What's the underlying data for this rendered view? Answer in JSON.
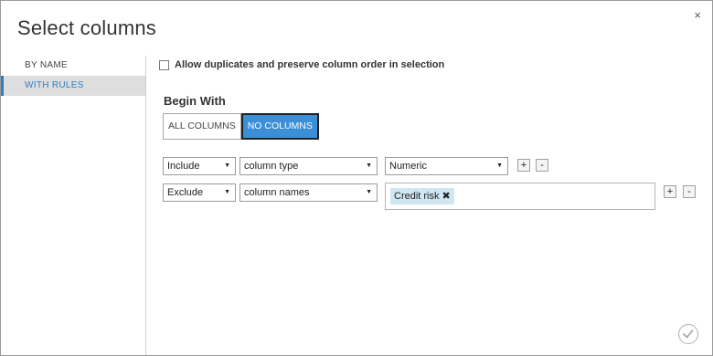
{
  "dialog": {
    "title": "Select columns",
    "close_glyph": "×"
  },
  "sidebar": {
    "items": [
      {
        "label": "BY NAME",
        "active": false
      },
      {
        "label": "WITH RULES",
        "active": true
      }
    ]
  },
  "allow": {
    "label": "Allow duplicates and preserve column order in selection",
    "checked": false
  },
  "begin_with": {
    "label": "Begin With",
    "options": [
      "ALL COLUMNS",
      "NO COLUMNS"
    ],
    "selected": "NO COLUMNS"
  },
  "rules": [
    {
      "action": "Include",
      "criterion": "column type",
      "value": "Numeric",
      "add": "+",
      "remove": "-"
    },
    {
      "action": "Exclude",
      "criterion": "column names",
      "tags": [
        {
          "label": "Credit risk",
          "remove_glyph": "✖"
        }
      ],
      "add": "+",
      "remove": "-"
    }
  ],
  "icons": {
    "dropdown": "chevron-down-icon",
    "ok": "checkmark-icon"
  },
  "colors": {
    "accent": "#3b8fd6",
    "tag": "#cfe6f3",
    "sidebar_active_bg": "#dedede"
  }
}
